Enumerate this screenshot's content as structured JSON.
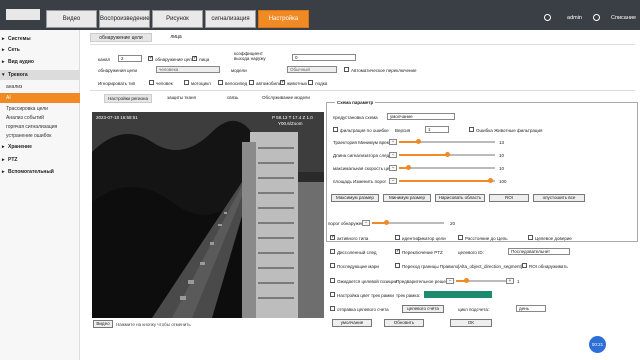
{
  "topbar": {
    "tabs": [
      "Видео",
      "Воспроизведение",
      "Рисунок",
      "сигнализация",
      "Настройка"
    ],
    "user": "admin",
    "logout": "Списание"
  },
  "sidebar": [
    {
      "label": "Системы",
      "type": "sec"
    },
    {
      "label": "Сеть",
      "type": "sec"
    },
    {
      "label": "Вид аудио",
      "type": "sec"
    },
    {
      "label": "Тревога",
      "type": "sec-open"
    },
    {
      "label": "анализ",
      "type": "sub"
    },
    {
      "label": "AI",
      "type": "active"
    },
    {
      "label": "Трассировка цели",
      "type": "sub"
    },
    {
      "label": "Анализ событий",
      "type": "sub"
    },
    {
      "label": "горячая сигнализация",
      "type": "sub"
    },
    {
      "label": "устранение ошибок",
      "type": "sub"
    },
    {
      "label": "Хранение",
      "type": "sec"
    },
    {
      "label": "PTZ",
      "type": "sec"
    },
    {
      "label": "Вспомогательный",
      "type": "sec"
    }
  ],
  "subtabs": [
    "обнаружение цели",
    "лица"
  ],
  "form": {
    "kanal_label": "канал",
    "kanal_value": "2",
    "cb_targets_label": "обнаружение цели",
    "cb_face_label": "лица",
    "coef_label": "коэффициент выхода наружу",
    "coef_value": "0",
    "obj_label": "обнаружения цели",
    "obj_value": "человека",
    "model_label": "модели",
    "model_value": "Обычный",
    "auto_label": "Автоматическое переключение",
    "ignore_label": "Игнорировать тип",
    "types": [
      "человек",
      "мотоцикл",
      "велосипед",
      "автомобиль",
      "животных",
      "лодка"
    ]
  },
  "content_tabs": [
    "Настройки региона",
    "защиты тканя",
    "связь",
    "Обслуживание модели"
  ],
  "video": {
    "timestamp": "2023-07-18 16:58:51",
    "pos": "P 58.13 T 17.4 Z 1.0",
    "zoom": "Y00.6/Zoom",
    "button": "Видео",
    "hint": "Нажмите на кнопку чтобы отменить"
  },
  "panel": {
    "title": "Схема параметр",
    "preset_label": "предустановка схема",
    "preset_value": "умолчание",
    "filter_label": "фильтрация по ошибке",
    "version_label": "Версия",
    "version_value": "1",
    "err_label": "Ошибка Животные фильтрация",
    "sliders": [
      {
        "label": "Траектория Минимум время",
        "value": "13",
        "level": 0.2
      },
      {
        "label": "Длина сигнализатора следа",
        "value": "10",
        "level": 0.5
      },
      {
        "label": "максимальная скорость цели",
        "value": "10",
        "level": 0.1
      },
      {
        "label": "площадь Изменить порог",
        "value": "100",
        "level": 0.95
      }
    ],
    "buttons": [
      "Максимум размер",
      "Минимум размер",
      "Нарисовать область",
      "ROI",
      "опустошить все"
    ]
  },
  "lower": {
    "threshold_label": "порог обнаружения",
    "threshold_value": "20",
    "threshold_level": 0.2,
    "row1": [
      "активного типа",
      "идентификатор цели",
      "Расстояние до Цель",
      "Целевое доверие"
    ],
    "row2_left": "Диссоленный след",
    "row2_mid": "Переключение PTZ",
    "row2_label3": "целевого ID:",
    "row2_select": "Последовательнет",
    "row3_left": "Последующие мари",
    "row3_mid": "Переход границы Правило",
    "row3_tag": "[Alta_object_direction_segment]",
    "row3_roi": "ROI обнаруживать",
    "row4_left": "Ожидается целевой позиции",
    "row4_mid": "Предварительное решение:",
    "row4_value": "1",
    "row5_left": "Настройка цвет трек рамки",
    "row5_mid": "трек рамка:",
    "color": "#1c8a6e",
    "row6_left": "отправка целевого счета",
    "row6_btn": "целевого счёта",
    "row6_label": "цикл подсчета:",
    "row6_select": "день",
    "buttons": [
      "умолчание",
      "Обновить",
      "OK"
    ]
  },
  "fab": "00:21"
}
